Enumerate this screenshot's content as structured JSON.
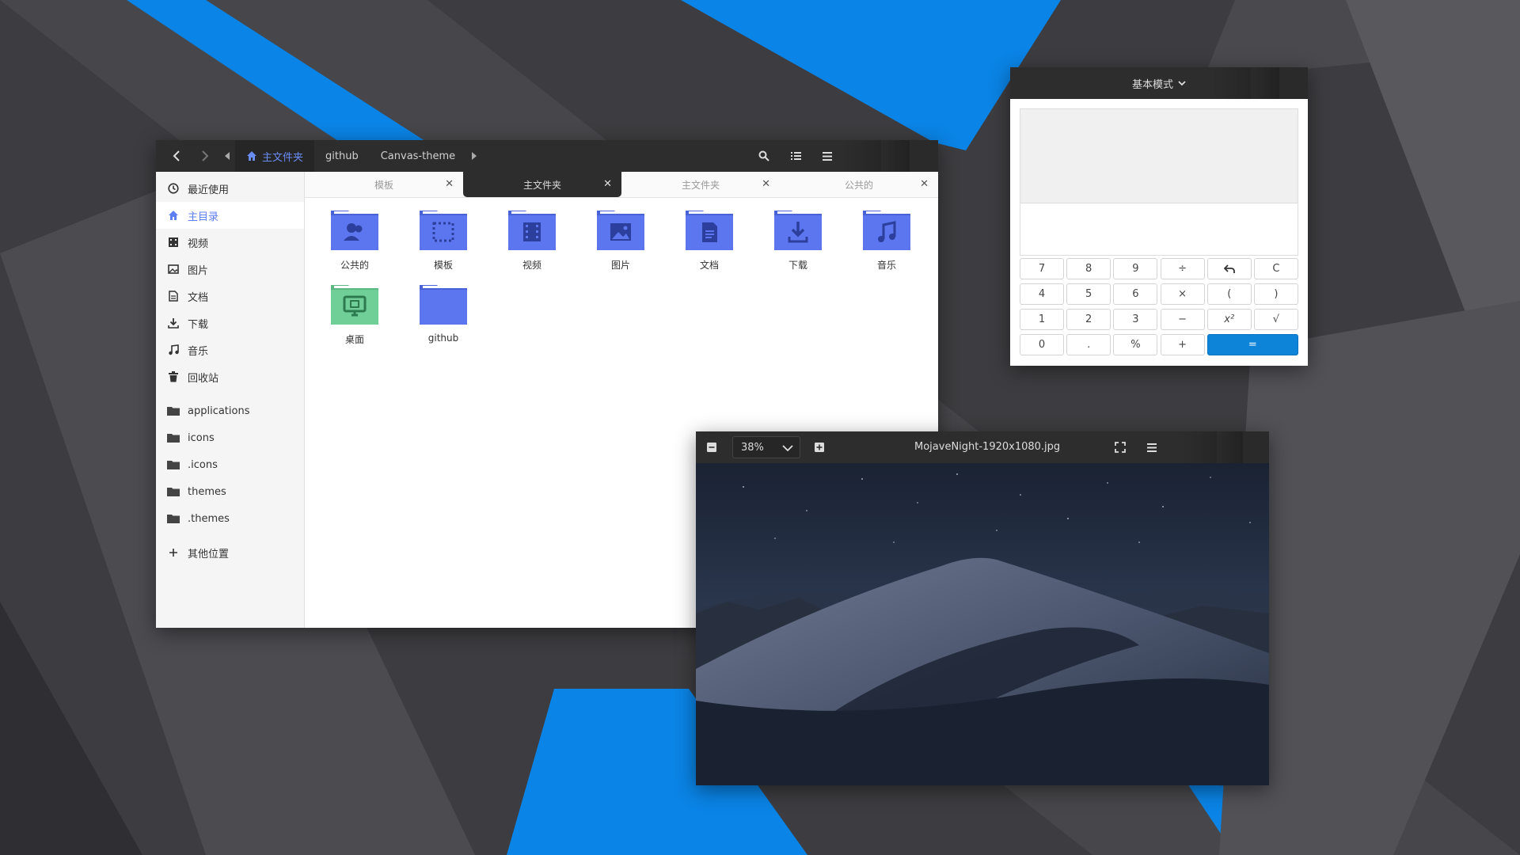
{
  "file_manager": {
    "breadcrumbs": [
      "主文件夹",
      "github",
      "Canvas-theme"
    ],
    "tabs": [
      {
        "label": "模板"
      },
      {
        "label": "主文件夹"
      },
      {
        "label": "主文件夹"
      },
      {
        "label": "公共的"
      }
    ],
    "sidebar": {
      "places": [
        {
          "label": "最近使用",
          "icon": "clock-icon"
        },
        {
          "label": "主目录",
          "icon": "home-icon"
        },
        {
          "label": "视频",
          "icon": "video-icon"
        },
        {
          "label": "图片",
          "icon": "image-icon"
        },
        {
          "label": "文档",
          "icon": "document-icon"
        },
        {
          "label": "下载",
          "icon": "download-icon"
        },
        {
          "label": "音乐",
          "icon": "music-icon"
        },
        {
          "label": "回收站",
          "icon": "trash-icon"
        }
      ],
      "bookmarks": [
        {
          "label": "applications"
        },
        {
          "label": "icons"
        },
        {
          "label": ".icons"
        },
        {
          "label": "themes"
        },
        {
          "label": ".themes"
        }
      ],
      "other_locations": "其他位置"
    },
    "folders": [
      {
        "label": "公共的",
        "icon": "people-icon"
      },
      {
        "label": "模板",
        "icon": "template-icon"
      },
      {
        "label": "视频",
        "icon": "video-icon"
      },
      {
        "label": "图片",
        "icon": "image-icon"
      },
      {
        "label": "文档",
        "icon": "document-icon"
      },
      {
        "label": "下载",
        "icon": "download-icon"
      },
      {
        "label": "音乐",
        "icon": "music-icon"
      },
      {
        "label": "桌面",
        "icon": "desktop-icon"
      },
      {
        "label": "github",
        "icon": "folder-icon"
      }
    ]
  },
  "calculator": {
    "mode": "基本模式",
    "keys": [
      "7",
      "8",
      "9",
      "÷",
      "↶",
      "C",
      "4",
      "5",
      "6",
      "×",
      "(",
      ")",
      "1",
      "2",
      "3",
      "−",
      "x²",
      "√",
      "0",
      ".",
      "%",
      "+",
      "="
    ]
  },
  "image_viewer": {
    "zoom": "38%",
    "filename": "MojaveNight-1920x1080.jpg"
  },
  "colors": {
    "accent": "#0d84d8",
    "folder_blue": "#5b76ee",
    "folder_green": "#6fcf97",
    "header_dark": "#2d2d2d"
  }
}
